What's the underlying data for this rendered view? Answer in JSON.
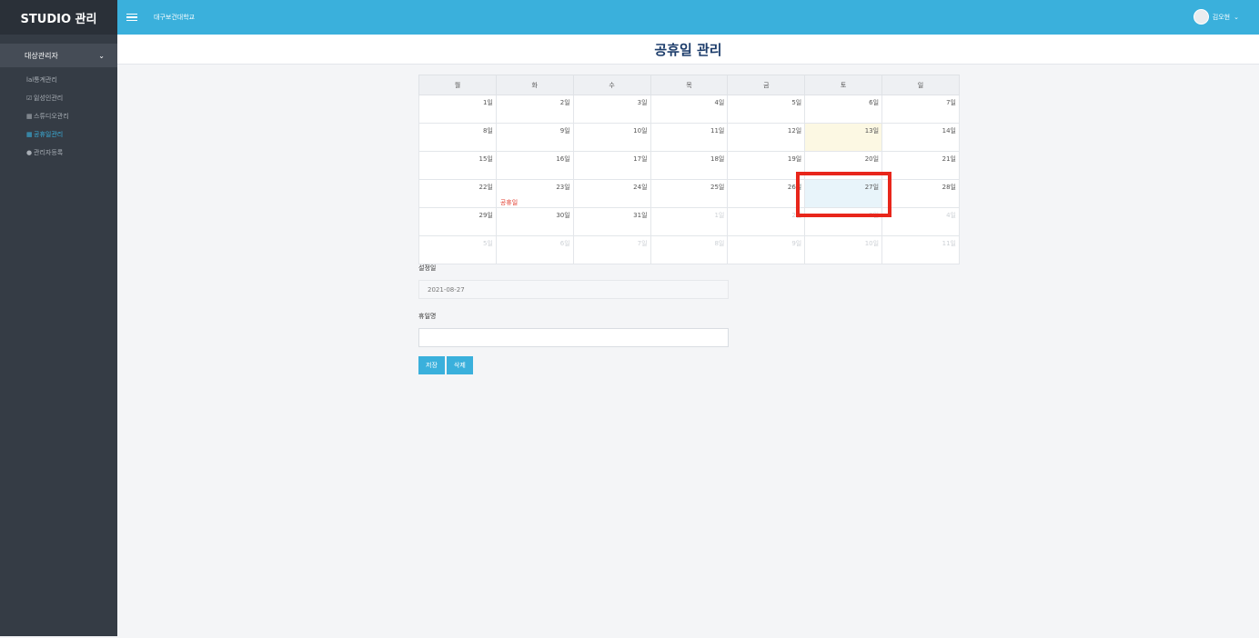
{
  "brand": "STUDIO 관리",
  "sidebar": {
    "section": "대상관리자",
    "items": [
      {
        "icon": "ㅣ",
        "label": "lal통계관리"
      },
      {
        "icon": "",
        "label": "잃성인관리"
      },
      {
        "icon": "",
        "label": "스튜디오관리"
      },
      {
        "icon": "",
        "label": "공휴일관리"
      },
      {
        "icon": "",
        "label": "관리자등록"
      }
    ]
  },
  "topbar": {
    "org": "대구보건대학교",
    "user": "김오현"
  },
  "page_title": "공휴일 관리",
  "calendar": {
    "weekdays": [
      "월",
      "화",
      "수",
      "목",
      "금",
      "토",
      "일"
    ],
    "weeks": [
      [
        "1일",
        "2일",
        "3일",
        "4일",
        "5일",
        "6일",
        "7일"
      ],
      [
        "8일",
        "9일",
        "10일",
        "11일",
        "12일",
        "13일",
        "14일"
      ],
      [
        "15일",
        "16일",
        "17일",
        "18일",
        "19일",
        "20일",
        "21일"
      ],
      [
        "22일",
        "23일",
        "24일",
        "25일",
        "26일",
        "27일",
        "28일"
      ],
      [
        "29일",
        "30일",
        "31일",
        "1일",
        "2일",
        "3일",
        "4일"
      ],
      [
        "5일",
        "6일",
        "7일",
        "8일",
        "9일",
        "10일",
        "11일"
      ]
    ],
    "event_label": "공휴일"
  },
  "form": {
    "date_label": "설정일",
    "date_value": "2021-08-27",
    "name_label": "휴일명",
    "name_value": "",
    "save_label": "저장",
    "delete_label": "삭제"
  },
  "colors": {
    "accent": "#3ab0dc",
    "sidebar": "#353c45",
    "highlight": "#e8261b",
    "event": "#e23c2e",
    "title": "#1d3d6b"
  }
}
